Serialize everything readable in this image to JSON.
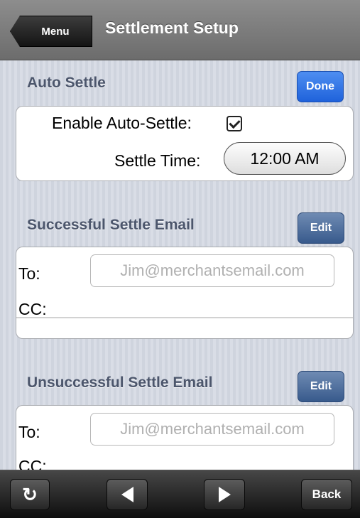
{
  "navbar": {
    "menu_label": "Menu",
    "title": "Settlement Setup"
  },
  "auto_settle": {
    "title": "Auto Settle",
    "done_label": "Done",
    "enable_label": "Enable Auto-Settle:",
    "enabled": true,
    "time_label": "Settle Time:",
    "time_value": "12:00 AM"
  },
  "success_email": {
    "title": "Successful Settle Email",
    "edit_label": "Edit",
    "to_label": "To:",
    "to_placeholder": "Jim@merchantsemail.com",
    "cc_label": "CC:"
  },
  "fail_email": {
    "title": "Unsuccessful Settle Email",
    "edit_label": "Edit",
    "to_label": "To:",
    "to_placeholder": "Jim@merchantsemail.com",
    "cc_label": "CC:"
  },
  "toolbar": {
    "refresh_icon": "refresh-icon",
    "prev_icon": "arrow-left-icon",
    "next_icon": "arrow-right-icon",
    "back_label": "Back"
  }
}
